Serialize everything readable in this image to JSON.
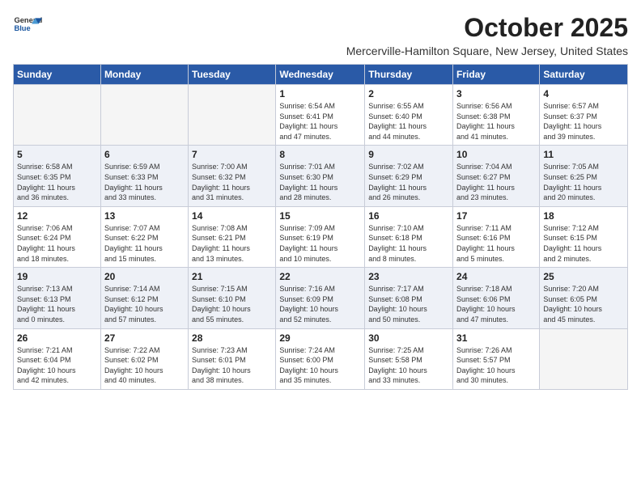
{
  "logo": {
    "general": "General",
    "blue": "Blue"
  },
  "title": "October 2025",
  "location": "Mercerville-Hamilton Square, New Jersey, United States",
  "days_header": [
    "Sunday",
    "Monday",
    "Tuesday",
    "Wednesday",
    "Thursday",
    "Friday",
    "Saturday"
  ],
  "weeks": [
    [
      {
        "day": "",
        "info": ""
      },
      {
        "day": "",
        "info": ""
      },
      {
        "day": "",
        "info": ""
      },
      {
        "day": "1",
        "info": "Sunrise: 6:54 AM\nSunset: 6:41 PM\nDaylight: 11 hours\nand 47 minutes."
      },
      {
        "day": "2",
        "info": "Sunrise: 6:55 AM\nSunset: 6:40 PM\nDaylight: 11 hours\nand 44 minutes."
      },
      {
        "day": "3",
        "info": "Sunrise: 6:56 AM\nSunset: 6:38 PM\nDaylight: 11 hours\nand 41 minutes."
      },
      {
        "day": "4",
        "info": "Sunrise: 6:57 AM\nSunset: 6:37 PM\nDaylight: 11 hours\nand 39 minutes."
      }
    ],
    [
      {
        "day": "5",
        "info": "Sunrise: 6:58 AM\nSunset: 6:35 PM\nDaylight: 11 hours\nand 36 minutes."
      },
      {
        "day": "6",
        "info": "Sunrise: 6:59 AM\nSunset: 6:33 PM\nDaylight: 11 hours\nand 33 minutes."
      },
      {
        "day": "7",
        "info": "Sunrise: 7:00 AM\nSunset: 6:32 PM\nDaylight: 11 hours\nand 31 minutes."
      },
      {
        "day": "8",
        "info": "Sunrise: 7:01 AM\nSunset: 6:30 PM\nDaylight: 11 hours\nand 28 minutes."
      },
      {
        "day": "9",
        "info": "Sunrise: 7:02 AM\nSunset: 6:29 PM\nDaylight: 11 hours\nand 26 minutes."
      },
      {
        "day": "10",
        "info": "Sunrise: 7:04 AM\nSunset: 6:27 PM\nDaylight: 11 hours\nand 23 minutes."
      },
      {
        "day": "11",
        "info": "Sunrise: 7:05 AM\nSunset: 6:25 PM\nDaylight: 11 hours\nand 20 minutes."
      }
    ],
    [
      {
        "day": "12",
        "info": "Sunrise: 7:06 AM\nSunset: 6:24 PM\nDaylight: 11 hours\nand 18 minutes."
      },
      {
        "day": "13",
        "info": "Sunrise: 7:07 AM\nSunset: 6:22 PM\nDaylight: 11 hours\nand 15 minutes."
      },
      {
        "day": "14",
        "info": "Sunrise: 7:08 AM\nSunset: 6:21 PM\nDaylight: 11 hours\nand 13 minutes."
      },
      {
        "day": "15",
        "info": "Sunrise: 7:09 AM\nSunset: 6:19 PM\nDaylight: 11 hours\nand 10 minutes."
      },
      {
        "day": "16",
        "info": "Sunrise: 7:10 AM\nSunset: 6:18 PM\nDaylight: 11 hours\nand 8 minutes."
      },
      {
        "day": "17",
        "info": "Sunrise: 7:11 AM\nSunset: 6:16 PM\nDaylight: 11 hours\nand 5 minutes."
      },
      {
        "day": "18",
        "info": "Sunrise: 7:12 AM\nSunset: 6:15 PM\nDaylight: 11 hours\nand 2 minutes."
      }
    ],
    [
      {
        "day": "19",
        "info": "Sunrise: 7:13 AM\nSunset: 6:13 PM\nDaylight: 11 hours\nand 0 minutes."
      },
      {
        "day": "20",
        "info": "Sunrise: 7:14 AM\nSunset: 6:12 PM\nDaylight: 10 hours\nand 57 minutes."
      },
      {
        "day": "21",
        "info": "Sunrise: 7:15 AM\nSunset: 6:10 PM\nDaylight: 10 hours\nand 55 minutes."
      },
      {
        "day": "22",
        "info": "Sunrise: 7:16 AM\nSunset: 6:09 PM\nDaylight: 10 hours\nand 52 minutes."
      },
      {
        "day": "23",
        "info": "Sunrise: 7:17 AM\nSunset: 6:08 PM\nDaylight: 10 hours\nand 50 minutes."
      },
      {
        "day": "24",
        "info": "Sunrise: 7:18 AM\nSunset: 6:06 PM\nDaylight: 10 hours\nand 47 minutes."
      },
      {
        "day": "25",
        "info": "Sunrise: 7:20 AM\nSunset: 6:05 PM\nDaylight: 10 hours\nand 45 minutes."
      }
    ],
    [
      {
        "day": "26",
        "info": "Sunrise: 7:21 AM\nSunset: 6:04 PM\nDaylight: 10 hours\nand 42 minutes."
      },
      {
        "day": "27",
        "info": "Sunrise: 7:22 AM\nSunset: 6:02 PM\nDaylight: 10 hours\nand 40 minutes."
      },
      {
        "day": "28",
        "info": "Sunrise: 7:23 AM\nSunset: 6:01 PM\nDaylight: 10 hours\nand 38 minutes."
      },
      {
        "day": "29",
        "info": "Sunrise: 7:24 AM\nSunset: 6:00 PM\nDaylight: 10 hours\nand 35 minutes."
      },
      {
        "day": "30",
        "info": "Sunrise: 7:25 AM\nSunset: 5:58 PM\nDaylight: 10 hours\nand 33 minutes."
      },
      {
        "day": "31",
        "info": "Sunrise: 7:26 AM\nSunset: 5:57 PM\nDaylight: 10 hours\nand 30 minutes."
      },
      {
        "day": "",
        "info": ""
      }
    ]
  ]
}
